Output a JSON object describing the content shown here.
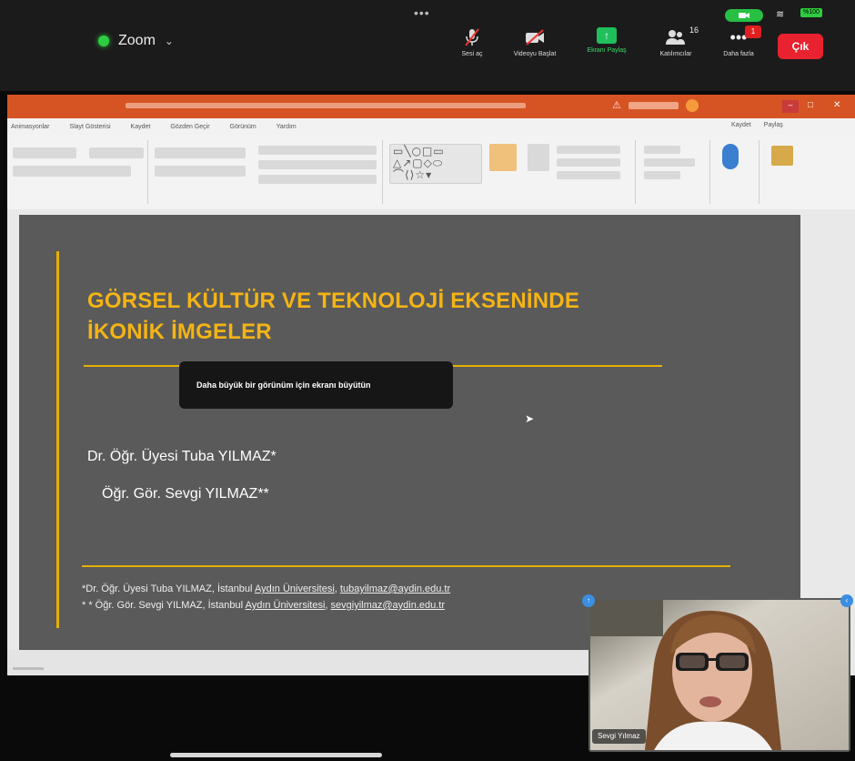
{
  "zoom": {
    "app_name": "Zoom",
    "grab_handle": "•••",
    "toolbar": [
      {
        "id": "mute",
        "label": "Sesi aç",
        "icon": "mic-muted-icon"
      },
      {
        "id": "video",
        "label": "Videoyu Başlat",
        "icon": "video-off-icon"
      },
      {
        "id": "share",
        "label": "Ekranı Paylaş",
        "icon": "share-screen-icon"
      },
      {
        "id": "participants",
        "label": "Katılımcılar",
        "icon": "participants-icon"
      },
      {
        "id": "more",
        "label": "Daha fazla",
        "icon": "more-icon"
      }
    ],
    "participant_count": "16",
    "more_badge": "1",
    "leave_label": "Çık",
    "status": {
      "wifi": "≋",
      "battery_percent": "%100"
    }
  },
  "ppt": {
    "ribbon_tabs": [
      "Animasyonlar",
      "Slayt Gösterisi",
      "Kaydet",
      "Gözden Geçir",
      "Görünüm",
      "Yardım"
    ],
    "ribbon_right": [
      "Kaydet",
      "Paylaş"
    ]
  },
  "slide": {
    "title_line1": "GÖRSEL KÜLTÜR VE TEKNOLOJİ EKSENİNDE",
    "title_line2": "İKONİK İMGELER",
    "author1": "Dr. Öğr. Üyesi Tuba YILMAZ*",
    "author2": "Öğr. Gör. Sevgi YILMAZ**",
    "footnote1_prefix": "*Dr. Öğr. Üyesi Tuba YILMAZ, İstanbul ",
    "footnote1_univ": "Aydın Üniversitesi",
    "footnote1_sep": ", ",
    "footnote1_email": "tubayilmaz@aydin.edu.tr",
    "footnote2_prefix": "* * Öğr. Gör. Sevgi YILMAZ, İstanbul ",
    "footnote2_univ": "Aydın Üniversitesi",
    "footnote2_sep": ", ",
    "footnote2_email": "sevgiyilmaz@aydin.edu.tr"
  },
  "tooltip": "Daha büyük bir görünüm için ekranı büyütün",
  "video": {
    "speaker_name": "Sevgi Yılmaz"
  },
  "colors": {
    "accent_gold": "#f4b415",
    "leave_red": "#e8222e",
    "share_green": "#1fbf5c",
    "ppt_orange": "#d65424"
  }
}
